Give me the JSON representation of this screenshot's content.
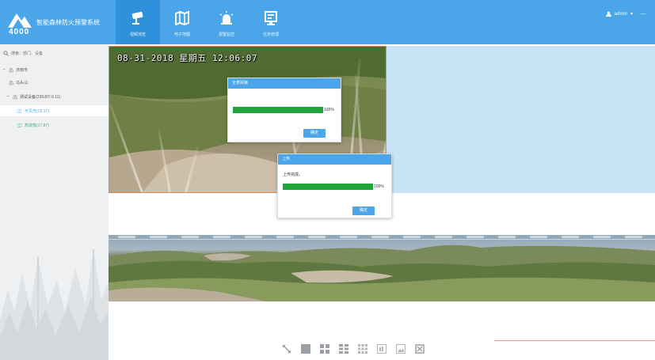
{
  "app": {
    "title": "智能森林防火预警系统",
    "logo_number": "4000"
  },
  "nav": [
    {
      "label": "视频浏览",
      "icon": "camera-icon",
      "active": true
    },
    {
      "label": "电子地图",
      "icon": "map-icon",
      "active": false
    },
    {
      "label": "报警监控",
      "icon": "alarm-icon",
      "active": false
    },
    {
      "label": "任务管理",
      "icon": "task-icon",
      "active": false
    }
  ],
  "user": {
    "name": "admin",
    "caret": "▾",
    "minimize": "—"
  },
  "sidebar": {
    "search_placeholder": "搜索：部门、设备",
    "tree": [
      {
        "label": "济南市",
        "toggle": "−",
        "icon": "org-icon",
        "indent": 0
      },
      {
        "label": "马头山",
        "toggle": "",
        "icon": "org-icon",
        "indent": 1
      },
      {
        "label": "测试设备(239.87/-9.11)",
        "toggle": "−",
        "icon": "org-icon",
        "indent": 1
      },
      {
        "label": "可见光(15.17)",
        "toggle": "",
        "icon": "camera-device-icon",
        "indent": 2,
        "selected": true
      },
      {
        "label": "热成像(17.87)",
        "toggle": "",
        "icon": "camera-device-icon",
        "indent": 2
      }
    ]
  },
  "video": {
    "osd": "08-31-2018 星期五 12:06:07"
  },
  "dialog_panorama": {
    "title": "全景拼接",
    "percent_label": "100%",
    "progress": 1.0,
    "ok_label": "确定"
  },
  "dialog_upload": {
    "title": "上传",
    "message": "上传完成。",
    "percent_label": "100%",
    "progress": 1.0,
    "ok_label": "确定"
  },
  "toolbar": [
    {
      "icon": "fullscreen-icon"
    },
    {
      "icon": "layout-1-icon"
    },
    {
      "icon": "layout-4-icon"
    },
    {
      "icon": "layout-6-icon"
    },
    {
      "icon": "layout-9-icon"
    },
    {
      "icon": "layout-mixed-icon"
    },
    {
      "icon": "picture-icon"
    },
    {
      "icon": "close-all-icon"
    }
  ],
  "colors": {
    "header": "#4aa6e8",
    "nav_active": "#2f91d9",
    "progress": "#21a63b",
    "button": "#4aa6e8",
    "sidebar_bg": "#eef0f2",
    "video_border": "#e08a54"
  }
}
